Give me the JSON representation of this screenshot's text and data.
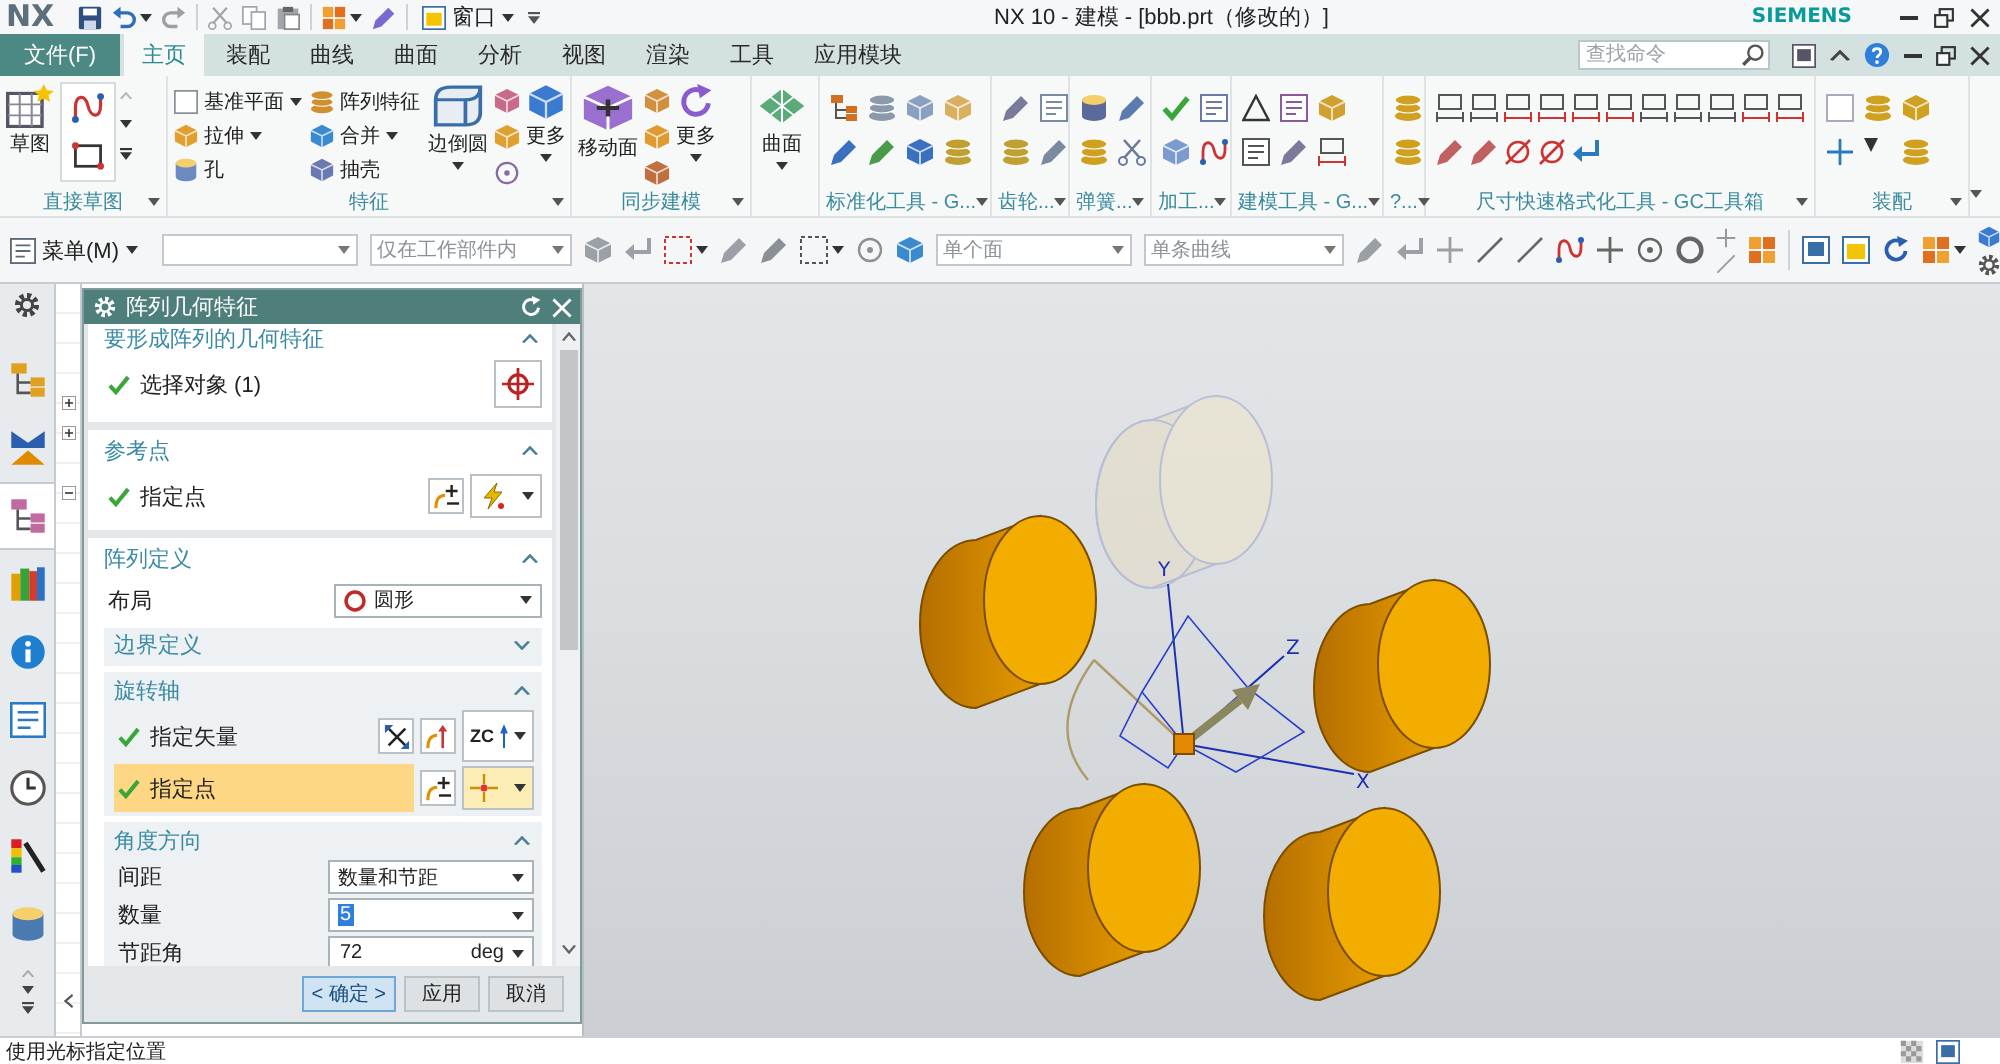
{
  "title_bar": {
    "logo": "NX",
    "window_menu": "窗口",
    "title": "NX 10 - 建模 - [bbb.prt（修改的）]",
    "brand": "SIEMENS"
  },
  "ribbon": {
    "file_menu": "文件(F)",
    "tabs": [
      {
        "label": "主页",
        "selected": true
      },
      {
        "label": "装配",
        "selected": false
      },
      {
        "label": "曲线",
        "selected": false
      },
      {
        "label": "曲面",
        "selected": false
      },
      {
        "label": "分析",
        "selected": false
      },
      {
        "label": "视图",
        "selected": false
      },
      {
        "label": "渲染",
        "selected": false
      },
      {
        "label": "工具",
        "selected": false
      },
      {
        "label": "应用模块",
        "selected": false
      }
    ],
    "search": {
      "placeholder": "查找命令"
    },
    "groups": [
      {
        "label": "直接草图",
        "buttons": [
          {
            "label": "草图",
            "dropdown": false
          }
        ]
      },
      {
        "label": "特征",
        "buttons": [
          {
            "label": "基准平面",
            "dropdown": true
          },
          {
            "label": "拉伸",
            "dropdown": true
          },
          {
            "label": "孔",
            "dropdown": false
          },
          {
            "label": "阵列特征",
            "dropdown": false
          },
          {
            "label": "合并",
            "dropdown": true
          },
          {
            "label": "抽壳",
            "dropdown": false
          },
          {
            "label": "边倒圆",
            "dropdown": true
          },
          {
            "label": "更多",
            "dropdown": true
          }
        ]
      },
      {
        "label": "同步建模",
        "buttons": [
          {
            "label": "移动面",
            "dropdown": false
          },
          {
            "label": "更多",
            "dropdown": true
          }
        ]
      },
      {
        "buttons": [
          {
            "label": "曲面",
            "dropdown": true
          }
        ]
      },
      {
        "label": "标准化工具 - G..."
      },
      {
        "label": "齿轮..."
      },
      {
        "label": "弹簧..."
      },
      {
        "label": "加工..."
      },
      {
        "label": "建模工具 - G..."
      },
      {
        "label": "?..."
      },
      {
        "label": "尺寸快速格式化工具 - GC工具箱"
      },
      {
        "label": "装配"
      }
    ]
  },
  "toolbar": {
    "menu": "菜单(M)",
    "filters": [
      {
        "value": "仅在工作部件内",
        "disabled": true
      },
      {
        "value": "单个面",
        "disabled": true
      },
      {
        "value": "单条曲线",
        "disabled": true
      }
    ]
  },
  "resource_bar": {
    "items": [
      {
        "selected": false
      },
      {
        "selected": false
      },
      {
        "selected": true
      },
      {
        "selected": false
      },
      {
        "selected": false
      },
      {
        "selected": false
      },
      {
        "selected": false
      },
      {
        "selected": false
      },
      {
        "selected": false
      }
    ]
  },
  "dialog": {
    "title": "阵列几何特征",
    "sections": [
      {
        "title": "要形成阵列的几何特征",
        "expanded": true,
        "rows": [
          {
            "kind": "select",
            "label": "选择对象 (1)",
            "complete": true,
            "active": false
          }
        ]
      },
      {
        "title": "参考点",
        "expanded": true,
        "rows": [
          {
            "kind": "point",
            "label": "指定点",
            "complete": true,
            "active": false
          }
        ]
      },
      {
        "title": "阵列定义",
        "expanded": true,
        "rows": [
          {
            "kind": "layout",
            "label": "布局",
            "value": "圆形"
          }
        ],
        "subsections": [
          {
            "title": "边界定义",
            "expanded": false
          },
          {
            "title": "旋转轴",
            "expanded": true,
            "rows": [
              {
                "kind": "vector",
                "label": "指定矢量",
                "complete": true,
                "active": false,
                "value": "ZC"
              },
              {
                "kind": "point",
                "label": "指定点",
                "complete": true,
                "active": true
              }
            ]
          },
          {
            "title": "角度方向",
            "expanded": true,
            "rows": [
              {
                "kind": "dropdown",
                "label": "间距",
                "value": "数量和节距"
              },
              {
                "kind": "number",
                "label": "数量",
                "value": "5",
                "value_selected": true
              },
              {
                "kind": "number",
                "label": "节距角",
                "value": "72",
                "unit": "deg",
                "value_selected": false
              }
            ]
          }
        ]
      }
    ],
    "buttons": [
      {
        "label": "< 确定 >",
        "default": true
      },
      {
        "label": "应用",
        "default": false
      },
      {
        "label": "取消",
        "default": false
      }
    ]
  },
  "viewport": {
    "triad": {
      "x": "X",
      "y": "Y",
      "z": "Z"
    }
  },
  "status_bar": {
    "message": "使用光标指定位置"
  }
}
